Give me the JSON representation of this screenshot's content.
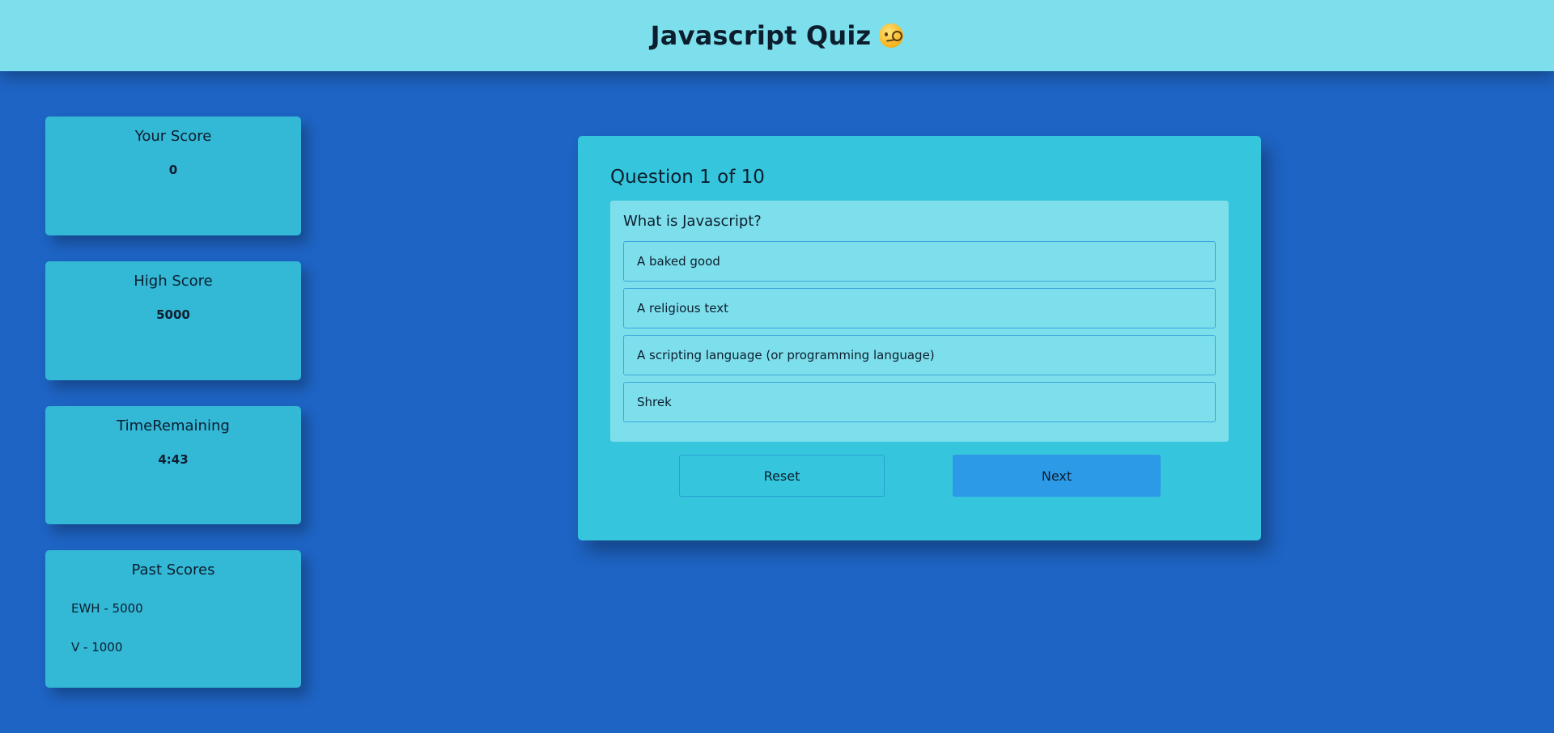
{
  "header": {
    "title": "Javascript Quiz",
    "emoji": "face-with-monocle-icon"
  },
  "sidebar": {
    "score": {
      "title": "Your Score",
      "value": "0"
    },
    "high_score": {
      "title": "High Score",
      "value": "5000"
    },
    "time": {
      "title": "TimeRemaining",
      "value": "4:43"
    },
    "past_scores": {
      "title": "Past Scores",
      "items": [
        "EWH - 5000",
        "V - 1000"
      ]
    }
  },
  "quiz": {
    "counter": "Question 1 of 10",
    "question": "What is Javascript?",
    "answers": [
      "A baked good",
      "A religious text",
      "A scripting language (or programming language)",
      "Shrek"
    ],
    "reset_label": "Reset",
    "next_label": "Next"
  },
  "colors": {
    "background": "#1e64c4",
    "header": "#7edfec",
    "card": "#33b8d6",
    "panel": "#35c5dc",
    "next_button": "#2c9ae6"
  }
}
